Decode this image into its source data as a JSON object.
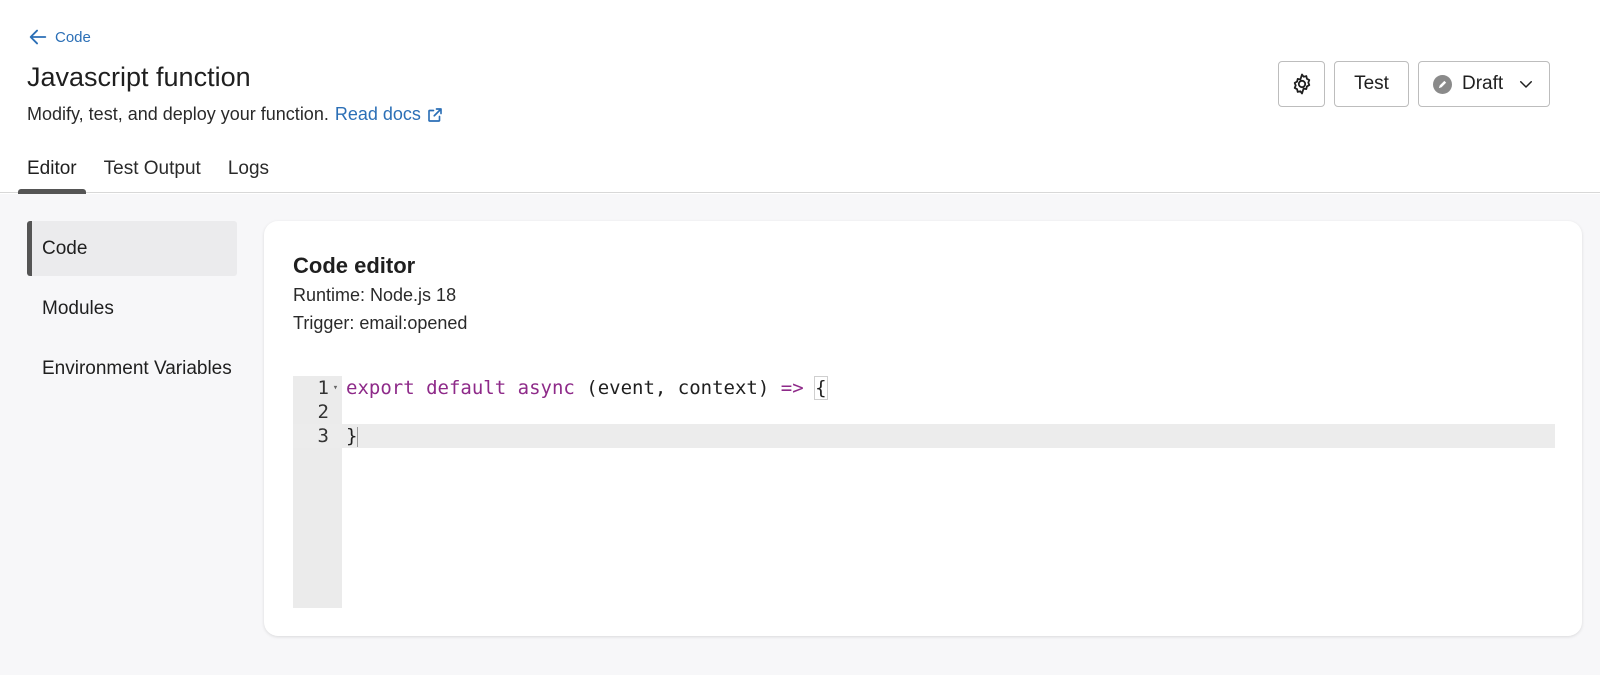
{
  "header": {
    "back_label": "Code",
    "title": "Javascript function",
    "subtitle": "Modify, test, and deploy your function.",
    "docs_link": "Read docs",
    "actions": {
      "test_label": "Test",
      "status_label": "Draft"
    }
  },
  "tabs": [
    {
      "label": "Editor",
      "active": true
    },
    {
      "label": "Test Output",
      "active": false
    },
    {
      "label": "Logs",
      "active": false
    }
  ],
  "sidebar": {
    "items": [
      {
        "label": "Code",
        "active": true
      },
      {
        "label": "Modules",
        "active": false
      },
      {
        "label": "Environment Variables",
        "active": false
      }
    ]
  },
  "editor_card": {
    "title": "Code editor",
    "runtime": "Runtime: Node.js 18",
    "trigger": "Trigger: email:opened",
    "lines": [
      {
        "number": "1",
        "tokens": {
          "k1": "export",
          "k2": "default",
          "k3": "async",
          "plain": "(event, context)",
          "arrow": "=>",
          "brace": "{"
        }
      },
      {
        "number": "2",
        "text": ""
      },
      {
        "number": "3",
        "text": "}"
      }
    ]
  },
  "colors": {
    "link": "#2b6fb6",
    "keyword": "#8e2a89",
    "active_indicator": "#555555"
  },
  "icons": {
    "back": "arrow-left-icon",
    "external": "external-link-icon",
    "settings": "gear-icon",
    "status": "status-dot-icon",
    "dropdown": "chevron-down-icon",
    "fold": "fold-triangle-icon"
  }
}
